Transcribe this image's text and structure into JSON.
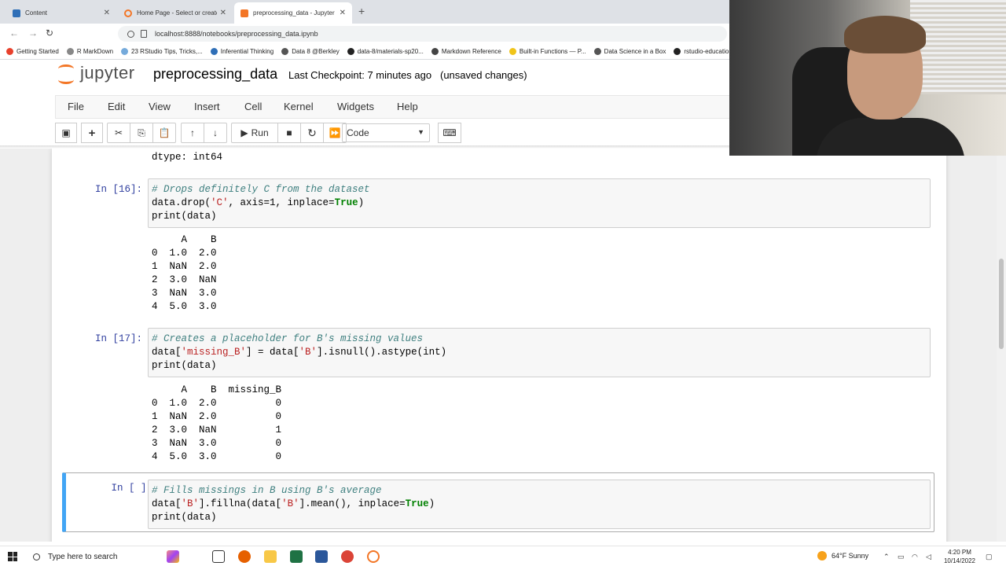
{
  "browser": {
    "tabs": [
      {
        "title": "Content",
        "color": "#2f6fb7"
      },
      {
        "title": "Home Page - Select or create a",
        "color": "#f37626"
      },
      {
        "title": "preprocessing_data - Jupyter N",
        "color": "#f37626"
      }
    ],
    "new_tab": "+",
    "url": "localhost:8888/notebooks/preprocessing_data.ipynb",
    "bookmarks": [
      {
        "label": "Getting Started",
        "color": "#e8412c"
      },
      {
        "label": "R MarkDown",
        "color": "#888888"
      },
      {
        "label": "23 RStudio Tips, Tricks,...",
        "color": "#75aadb"
      },
      {
        "label": "Inferential Thinking",
        "color": "#2f6fb7"
      },
      {
        "label": "Data 8 @Berkley",
        "color": "#555555"
      },
      {
        "label": "data-8/materials-sp20...",
        "color": "#222222"
      },
      {
        "label": "Markdown Reference",
        "color": "#444444"
      },
      {
        "label": "Built-in Functions — P...",
        "color": "#f0c419"
      },
      {
        "label": "Data Science in a Box",
        "color": "#555555"
      },
      {
        "label": "rstudio-education/dat...",
        "color": "#222222"
      }
    ]
  },
  "jupyter": {
    "logo_text": "jupyter",
    "notebook_name": "preprocessing_data",
    "checkpoint": "Last Checkpoint: 7 minutes ago",
    "status": "(unsaved changes)",
    "menu": [
      "File",
      "Edit",
      "View",
      "Insert",
      "Cell",
      "Kernel",
      "Widgets",
      "Help"
    ],
    "toolbar": {
      "run_label": "Run",
      "cell_type": "Code"
    }
  },
  "notebook": {
    "prev_output_tail": "dtype: int64",
    "cells": [
      {
        "prompt": "In [16]:",
        "code": {
          "comment": "# Drops definitely C from the dataset",
          "line2_pre": "data.drop(",
          "line2_str": "'C'",
          "line2_mid": ", axis=1, inplace=",
          "line2_kw": "True",
          "line2_post": ")",
          "line3": "print(data)"
        },
        "output": [
          "     A    B",
          "0  1.0  2.0",
          "1  NaN  2.0",
          "2  3.0  NaN",
          "3  NaN  3.0",
          "4  5.0  3.0"
        ]
      },
      {
        "prompt": "In [17]:",
        "code": {
          "comment": "# Creates a placeholder for B's missing values",
          "line2_pre": "data[",
          "line2_str": "'missing_B'",
          "line2_mid": "] = data[",
          "line2_str2": "'B'",
          "line2_post": "].isnull().astype(int)",
          "line3": "print(data)"
        },
        "output": [
          "     A    B  missing_B",
          "0  1.0  2.0          0",
          "1  NaN  2.0          0",
          "2  3.0  NaN          1",
          "3  NaN  3.0          0",
          "4  5.0  3.0          0"
        ]
      },
      {
        "prompt": "In [ ]:",
        "code": {
          "comment": "# Fills missings in B using B's average",
          "line2_pre": "data[",
          "line2_str": "'B'",
          "line2_mid": "].fillna(data[",
          "line2_str2": "'B'",
          "line2_mid2": "].mean(), inplace=",
          "line2_kw": "True",
          "line2_post": ")",
          "line3": "print(data)"
        }
      }
    ]
  },
  "taskbar": {
    "search_placeholder": "Type here to search",
    "weather": "64°F  Sunny",
    "time": "4:20 PM",
    "date": "10/14/2022"
  }
}
